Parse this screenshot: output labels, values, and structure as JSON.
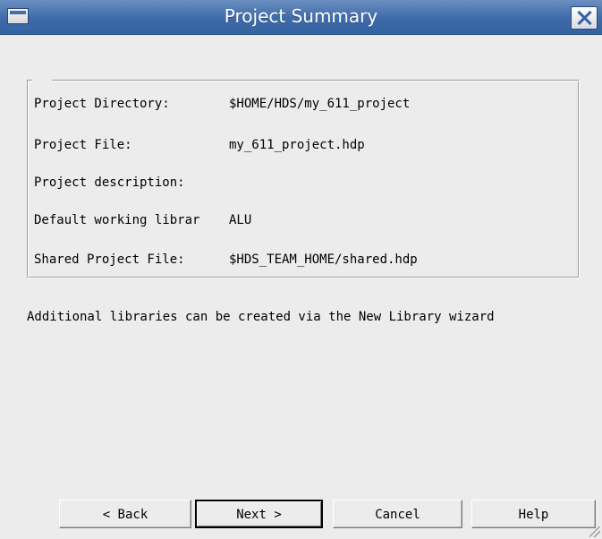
{
  "window": {
    "title": "Project Summary"
  },
  "summary": {
    "rows": [
      {
        "label": "Project Directory:",
        "value": "$HOME/HDS/my_611_project"
      },
      {
        "label": "Project File:",
        "value": "my_611_project.hdp"
      },
      {
        "label": "Project description:",
        "value": ""
      },
      {
        "label": "Default working librar",
        "value": "ALU"
      },
      {
        "label": "Shared Project File:",
        "value": "$HDS_TEAM_HOME/shared.hdp"
      }
    ]
  },
  "info_text": "Additional libraries can be created via the New Library wizard",
  "buttons": {
    "back": "< Back",
    "next": "Next >",
    "cancel": "Cancel",
    "help": "Help"
  },
  "icons": {
    "window_menu": "window-menu-icon",
    "close": "close-icon",
    "resize": "resize-grip-icon"
  },
  "colors": {
    "titlebar": "#3f6aa8",
    "background": "#ececec"
  }
}
